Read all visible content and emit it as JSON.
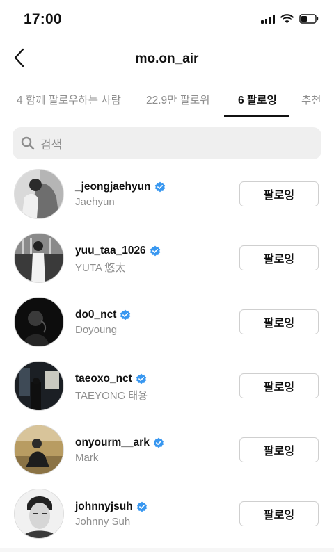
{
  "status_bar": {
    "time": "17:00"
  },
  "header": {
    "title": "mo.on_air"
  },
  "tabs": [
    {
      "label": "4 함께 팔로우하는 사람",
      "active": false
    },
    {
      "label": "22.9만 팔로워",
      "active": false
    },
    {
      "label": "6 팔로잉",
      "active": true
    },
    {
      "label": "추천",
      "active": false
    }
  ],
  "search": {
    "placeholder": "검색"
  },
  "accounts": [
    {
      "username": "_jeongjaehyun",
      "full_name": "Jaehyun",
      "verified": true,
      "button": "팔로잉"
    },
    {
      "username": "yuu_taa_1026",
      "full_name": "YUTA 悠太",
      "verified": true,
      "button": "팔로잉"
    },
    {
      "username": "do0_nct",
      "full_name": "Doyoung",
      "verified": true,
      "button": "팔로잉"
    },
    {
      "username": "taeoxo_nct",
      "full_name": "TAEYONG 태용",
      "verified": true,
      "button": "팔로잉"
    },
    {
      "username": "onyourm__ark",
      "full_name": "Mark",
      "verified": true,
      "button": "팔로잉"
    },
    {
      "username": "johnnyjsuh",
      "full_name": "Johnny Suh",
      "verified": true,
      "button": "팔로잉"
    }
  ],
  "colors": {
    "verified_badge": "#3897f0",
    "secondary_text": "#8e8e8e",
    "search_bg": "#efefef"
  }
}
